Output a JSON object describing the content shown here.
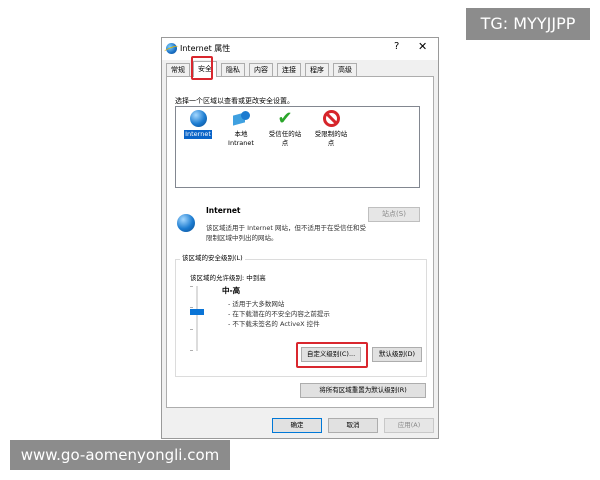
{
  "watermarks": {
    "top": "TG: MYYJJPP",
    "bottom": "www.go-aomenyongli.com"
  },
  "dialog": {
    "title": "Internet 属性",
    "title_icon": "internet-explorer-icon",
    "help_symbol": "?",
    "close_symbol": "✕"
  },
  "tabs": [
    {
      "label": "常规",
      "selected": false
    },
    {
      "label": "安全",
      "selected": true
    },
    {
      "label": "隐私",
      "selected": false
    },
    {
      "label": "内容",
      "selected": false
    },
    {
      "label": "连接",
      "selected": false
    },
    {
      "label": "程序",
      "selected": false
    },
    {
      "label": "高级",
      "selected": false
    }
  ],
  "security": {
    "zone_prompt": "选择一个区域以查看或更改安全设置。",
    "zones": [
      {
        "label": "Internet",
        "icon": "globe-icon",
        "selected": true
      },
      {
        "label": "本地 Intranet",
        "icon": "intranet-icon",
        "selected": false
      },
      {
        "label": "受信任的站点",
        "icon": "checkmark-icon",
        "selected": false
      },
      {
        "label": "受限制的站点",
        "icon": "blocked-icon",
        "selected": false
      }
    ],
    "selected_zone": {
      "name": "Internet",
      "description": "该区域适用于 Internet 网站，但不适用于在受信任和受限制区域中列出的网站。",
      "sites_button": "站点(S)"
    },
    "level": {
      "group_title": "该区域的安全级别(L)",
      "allowed": "该区域的允许级别: 中到高",
      "name": "中-高",
      "bullets": [
        "适用于大多数网站",
        "在下载潜在的不安全内容之前提示",
        "不下载未签名的 ActiveX 控件"
      ],
      "slider_value": "中-高",
      "custom_button": "自定义级别(C)...",
      "default_button": "默认级别(D)"
    },
    "reset_all_button": "将所有区域重置为默认级别(R)"
  },
  "footer": {
    "ok": "确定",
    "cancel": "取消",
    "apply": "应用(A)"
  },
  "colors": {
    "highlight": "#d9272e",
    "selection": "#0a64c8",
    "slider": "#0a74d6"
  }
}
